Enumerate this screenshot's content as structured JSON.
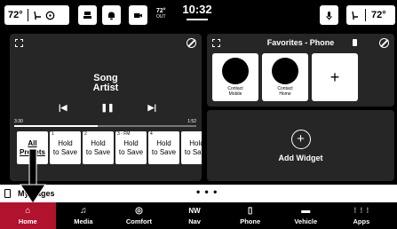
{
  "status_bar": {
    "driver_temp": "72°",
    "passenger_temp": "72°",
    "outside_temp": "72°",
    "outside_temp_unit": "OUT",
    "clock": "10:32"
  },
  "media": {
    "song": "Song",
    "artist": "Artist",
    "elapsed": "3:30",
    "duration": "1:52",
    "progress": 0.46,
    "presets": [
      {
        "num": "",
        "label_line1": "All",
        "label_line2": "Presets"
      },
      {
        "num": "1",
        "label_line1": "Hold",
        "label_line2": "to Save"
      },
      {
        "num": "2",
        "label_line1": "Hold",
        "label_line2": "to Save"
      },
      {
        "num": "3 - FM",
        "label_line1": "Hold",
        "label_line2": "to Save"
      },
      {
        "num": "4",
        "label_line1": "Hold",
        "label_line2": "to Save"
      },
      {
        "num": "",
        "label_line1": "Hold",
        "label_line2": "to Save"
      }
    ]
  },
  "favorites": {
    "title": "Favorites - Phone",
    "contacts": [
      {
        "label_line1": "Contact",
        "label_line2": "Mobile"
      },
      {
        "label_line1": "Contact",
        "label_line2": "Home"
      }
    ],
    "add_symbol": "+"
  },
  "widget": {
    "add_label": "Add Widget",
    "add_symbol": "+"
  },
  "pages": {
    "label": "My Pages",
    "dots": "• • •"
  },
  "nav": {
    "items": [
      {
        "label": "Home",
        "icon": "home-icon",
        "glyph": "⌂"
      },
      {
        "label": "Media",
        "icon": "music-note-icon",
        "glyph": "♫"
      },
      {
        "label": "Comfort",
        "icon": "steering-wheel-icon",
        "glyph": "◎"
      },
      {
        "label": "Nav",
        "icon": "compass-icon",
        "glyph": "NW"
      },
      {
        "label": "Phone",
        "icon": "phone-icon",
        "glyph": "▯"
      },
      {
        "label": "Vehicle",
        "icon": "car-icon",
        "glyph": "▬"
      },
      {
        "label": "Apps",
        "icon": "apps-grid-icon",
        "glyph": "⋮⋮⋮"
      }
    ],
    "active_color": "#b1122d"
  }
}
